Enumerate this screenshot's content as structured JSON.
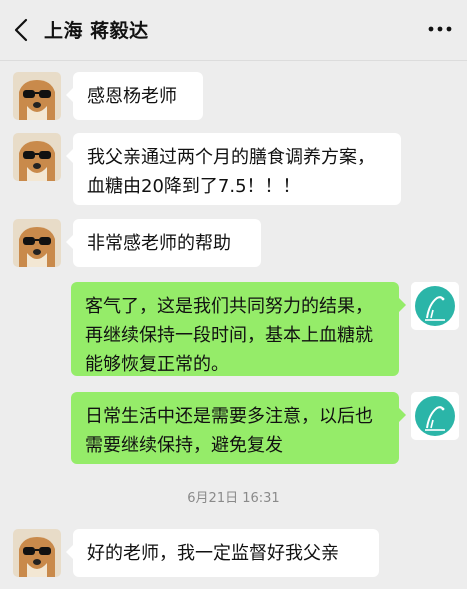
{
  "header": {
    "title": "上海 蒋毅达",
    "back_icon": "chevron-left-icon",
    "more_icon": "more-dots-icon"
  },
  "messages": [
    {
      "sender": "contact",
      "text": "感恩杨老师"
    },
    {
      "sender": "contact",
      "text": "我父亲通过两个月的膳食调养方案，血糖由20降到了7.5！！！"
    },
    {
      "sender": "contact",
      "text": "非常感老师的帮助"
    },
    {
      "sender": "self",
      "text": "客气了，这是我们共同努力的结果，再继续保持一段时间，基本上血糖就能够恢复正常的。"
    },
    {
      "sender": "self",
      "text": "日常生活中还是需要多注意，以后也需要继续保持，避免复发"
    },
    {
      "sender": "contact",
      "text": "好的老师，我一定监督好我父亲"
    }
  ],
  "timestamp": "6月21日 16:31",
  "colors": {
    "background": "#ededed",
    "incoming_bubble": "#ffffff",
    "outgoing_bubble": "#95ec69",
    "self_avatar_accent": "#2bb5a8"
  }
}
